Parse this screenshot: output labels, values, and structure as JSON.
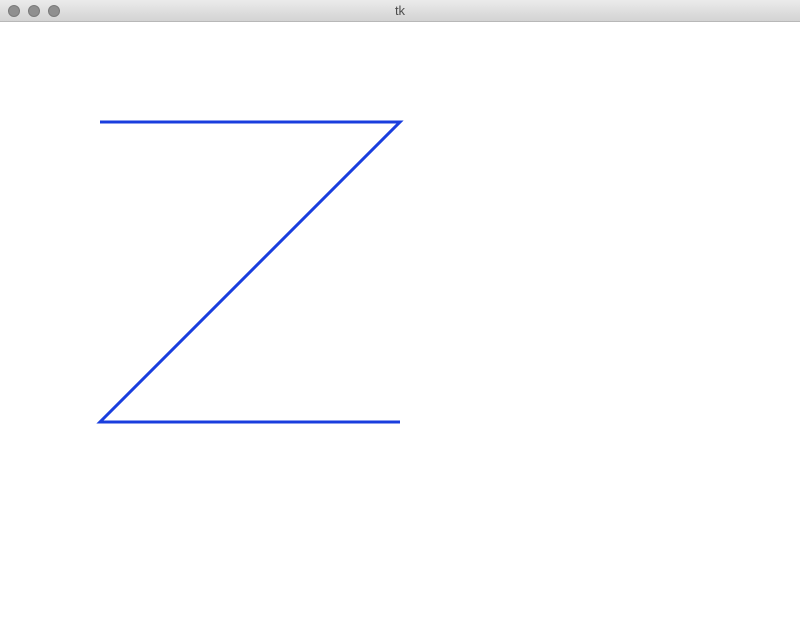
{
  "window": {
    "title": "tk"
  },
  "canvas": {
    "stroke_color": "#1a3ede",
    "shape": "polyline-z"
  }
}
